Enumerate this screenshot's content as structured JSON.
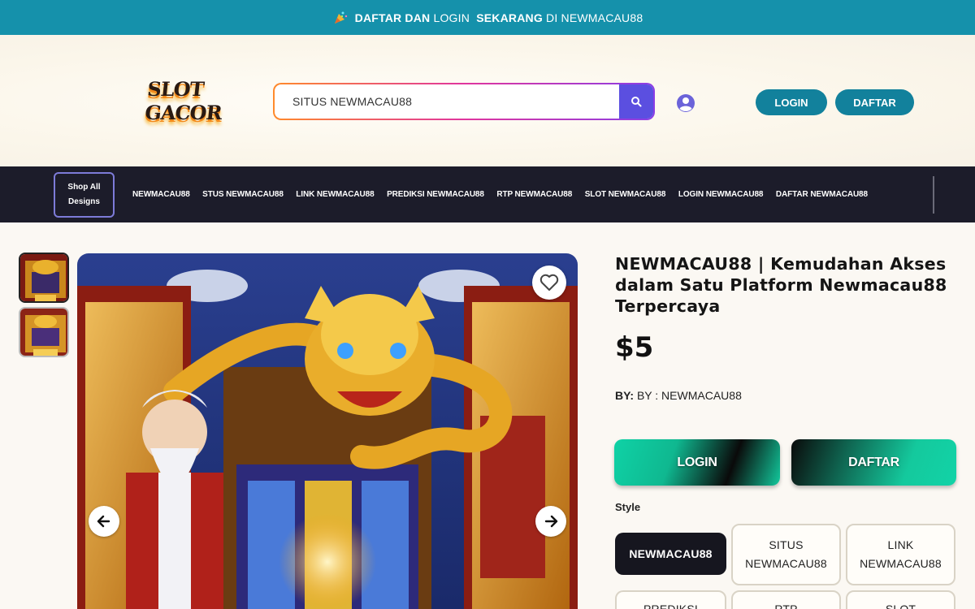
{
  "announcement": {
    "part1": "DAFTAR DAN",
    "part2": "LOGIN",
    "part3": "SEKARANG",
    "part4": "DI NEWMACAU88",
    "icon": "party-icon"
  },
  "header": {
    "logo_text": "SLOT GACOR",
    "search_value": "SITUS NEWMACAU88",
    "login_label": "LOGIN",
    "daftar_label": "DAFTAR"
  },
  "nav": {
    "shop_all_line1": "Shop All",
    "shop_all_line2": "Designs",
    "links": [
      "NEWMACAU88",
      "STUS NEWMACAU88",
      "LINK NEWMACAU88",
      "PREDIKSI NEWMACAU88",
      "RTP NEWMACAU88",
      "SLOT NEWMACAU88",
      "LOGIN NEWMACAU88",
      "DAFTAR NEWMACAU88"
    ]
  },
  "product": {
    "title": "NEWMACAU88 | Kemudahan Akses dalam Satu Platform Newmacau88 Terpercaya",
    "price": "$5",
    "by_label": "BY:",
    "by_value": "BY : NEWMACAU88",
    "login_cta": "LOGIN",
    "daftar_cta": "DAFTAR",
    "style_label": "Style",
    "options": [
      {
        "line1": "NEWMACAU88",
        "line2": ""
      },
      {
        "line1": "SITUS",
        "line2": "NEWMACAU88"
      },
      {
        "line1": "LINK",
        "line2": "NEWMACAU88"
      },
      {
        "line1": "PREDIKSI",
        "line2": ""
      },
      {
        "line1": "RTP",
        "line2": ""
      },
      {
        "line1": "SLOT",
        "line2": ""
      }
    ]
  },
  "colors": {
    "topbar": "#1591ab",
    "nav_bg": "#1c1c2a",
    "pill": "#12819c",
    "cta_green": "#12c99d",
    "search_btn": "#5b4fe0"
  }
}
